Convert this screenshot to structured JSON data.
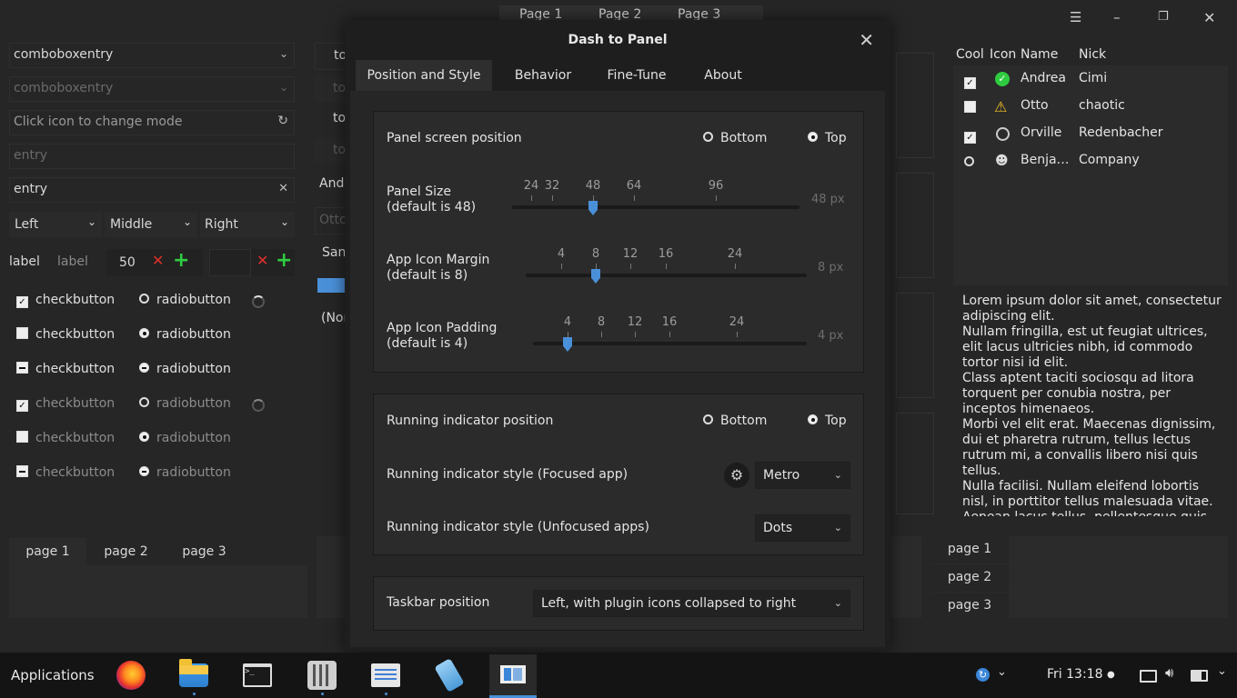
{
  "background": {
    "top_tabs": [
      "Page 1",
      "Page 2",
      "Page 3"
    ],
    "combos": [
      {
        "value": "comboboxentry"
      },
      {
        "value": "comboboxentry"
      },
      {
        "value": "Click icon to change mode"
      },
      {
        "value": "entry"
      },
      {
        "value": "entry"
      }
    ],
    "align": [
      "Left",
      "Middle",
      "Right"
    ],
    "label_row": {
      "label1": "label",
      "label2": "label",
      "spin": "50"
    },
    "checks": [
      "checkbutton",
      "checkbutton",
      "checkbutton",
      "checkbutton",
      "checkbutton",
      "checkbutton"
    ],
    "radios": [
      "radiobutton",
      "radiobutton",
      "radiobutton",
      "radiobutton",
      "radiobutton",
      "radiobutton"
    ],
    "middle_bits": [
      "to",
      "to",
      "to",
      "to",
      "Andr",
      "Otto",
      "Sans",
      "(Non"
    ],
    "bottom_tabs": [
      "page 1",
      "page 2",
      "page 3"
    ],
    "tree": {
      "headers": [
        "Cool",
        "Icon",
        "Name",
        "Nick"
      ],
      "rows": [
        {
          "name": "Andrea",
          "nick": "Cimi"
        },
        {
          "name": "Otto",
          "nick": "chaotic"
        },
        {
          "name": "Orville",
          "nick": "Redenbacher"
        },
        {
          "name": "Benja…",
          "nick": "Company"
        }
      ]
    },
    "lorem": [
      "Lorem ipsum dolor sit amet, consectetur",
      "adipiscing elit.",
      "Nullam fringilla, est ut feugiat ultrices,",
      "elit lacus ultricies nibh, id commodo",
      "tortor nisi id elit.",
      "Class aptent taciti sociosqu ad litora",
      "torquent per conubia nostra, per",
      "inceptos himenaeos.",
      "Morbi vel elit erat. Maecenas dignissim,",
      "dui et pharetra rutrum, tellus lectus",
      "rutrum mi, a convallis libero nisi quis",
      "tellus.",
      "Nulla facilisi. Nullam eleifend lobortis",
      "nisl, in porttitor tellus malesuada vitae.",
      "Aenean lacus tellus, pellentesque quis"
    ],
    "side_tabs": [
      "page 1",
      "page 2",
      "page 3"
    ]
  },
  "dialog": {
    "title": "Dash to Panel",
    "tabs": [
      "Position and Style",
      "Behavior",
      "Fine-Tune",
      "About"
    ],
    "panel_position": {
      "label": "Panel screen position",
      "opt1": "Bottom",
      "opt2": "Top"
    },
    "panel_size": {
      "label1": "Panel Size",
      "label2": "(default is 48)",
      "marks": [
        "24",
        "32",
        "48",
        "64",
        "96"
      ],
      "value": "48 px",
      "level": 48
    },
    "icon_margin": {
      "label1": "App Icon Margin",
      "label2": "(default is 8)",
      "marks": [
        "4",
        "8",
        "12",
        "16",
        "24"
      ],
      "value": "8 px",
      "level": 8
    },
    "icon_padding": {
      "label1": "App Icon Padding",
      "label2": "(default is 4)",
      "marks": [
        "4",
        "8",
        "12",
        "16",
        "24"
      ],
      "value": "4 px",
      "level": 4
    },
    "running_position": {
      "label": "Running indicator position",
      "opt1": "Bottom",
      "opt2": "Top"
    },
    "style_focused": {
      "label": "Running indicator style (Focused app)",
      "value": "Metro"
    },
    "style_unfocused": {
      "label": "Running indicator style (Unfocused apps)",
      "value": "Dots"
    },
    "taskbar_position": {
      "label": "Taskbar position",
      "value": "Left, with plugin icons collapsed to right"
    }
  },
  "taskbar": {
    "apps_label": "Applications",
    "clock": "Fri 13:18"
  },
  "colors": {
    "accent": "#4a90d9",
    "check_green": "#2ecc40",
    "warn_yellow": "#f2c029"
  }
}
